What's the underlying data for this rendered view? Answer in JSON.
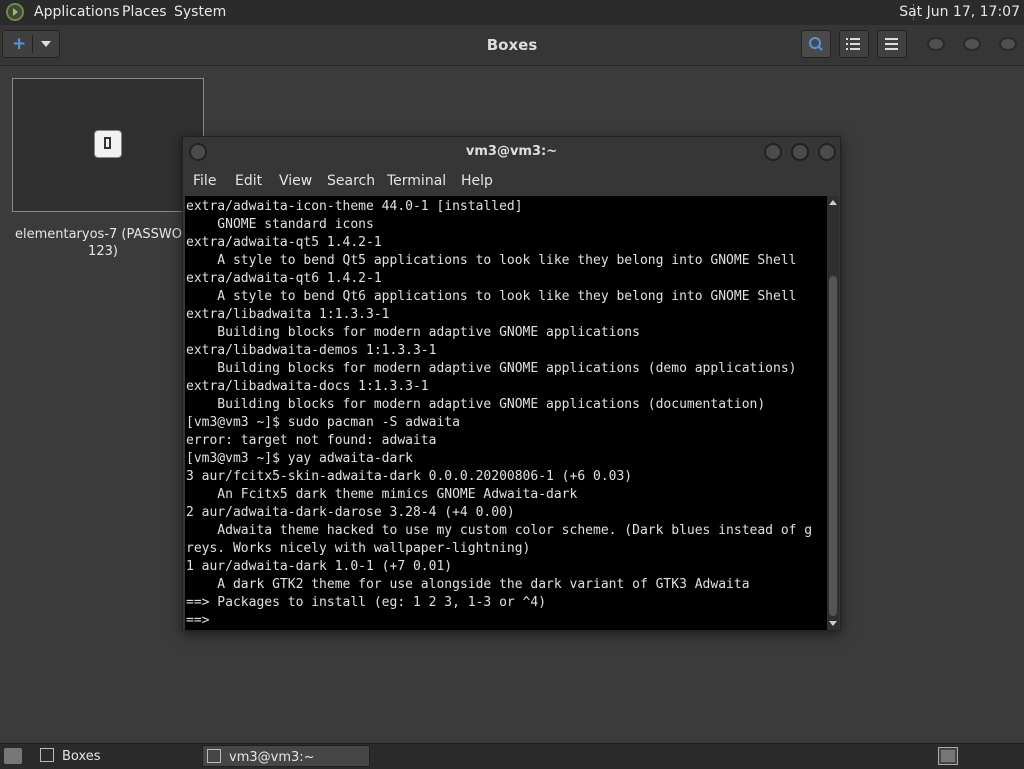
{
  "top_panel": {
    "menu_applications": "Applications",
    "menu_places": "Places",
    "menu_system": "System",
    "clock": "Sat Jun 17, 17:07"
  },
  "boxes": {
    "title": "Boxes",
    "new_button_label": "+",
    "vm": {
      "name_line1": "elementaryos-7 (PASSWOR",
      "name_line2": "123)"
    }
  },
  "terminal": {
    "window_title": "vm3@vm3:~",
    "menu": [
      "File",
      "Edit",
      "View",
      "Search",
      "Terminal",
      "Help"
    ],
    "lines": [
      "extra/adwaita-icon-theme 44.0-1 [installed]",
      "    GNOME standard icons",
      "extra/adwaita-qt5 1.4.2-1",
      "    A style to bend Qt5 applications to look like they belong into GNOME Shell",
      "extra/adwaita-qt6 1.4.2-1",
      "    A style to bend Qt6 applications to look like they belong into GNOME Shell",
      "extra/libadwaita 1:1.3.3-1",
      "    Building blocks for modern adaptive GNOME applications",
      "extra/libadwaita-demos 1:1.3.3-1",
      "    Building blocks for modern adaptive GNOME applications (demo applications)",
      "extra/libadwaita-docs 1:1.3.3-1",
      "    Building blocks for modern adaptive GNOME applications (documentation)",
      "[vm3@vm3 ~]$ sudo pacman -S adwaita",
      "error: target not found: adwaita",
      "[vm3@vm3 ~]$ yay adwaita-dark",
      "3 aur/fcitx5-skin-adwaita-dark 0.0.0.20200806-1 (+6 0.03)",
      "    An Fcitx5 dark theme mimics GNOME Adwaita-dark",
      "2 aur/adwaita-dark-darose 3.28-4 (+4 0.00)",
      "    Adwaita theme hacked to use my custom color scheme. (Dark blues instead of g",
      "reys. Works nicely with wallpaper-lightning)",
      "1 aur/adwaita-dark 1.0-1 (+7 0.01)",
      "    A dark GTK2 theme for use alongside the dark variant of GTK3 Adwaita",
      "==> Packages to install (eg: 1 2 3, 1-3 or ^4)",
      "==> "
    ]
  },
  "taskbar": {
    "task_boxes": "Boxes",
    "task_terminal": "vm3@vm3:~"
  },
  "colors": {
    "accent": "#5294e2",
    "terminal_bg": "#000000",
    "desktop_bg": "#3b3b3b"
  }
}
